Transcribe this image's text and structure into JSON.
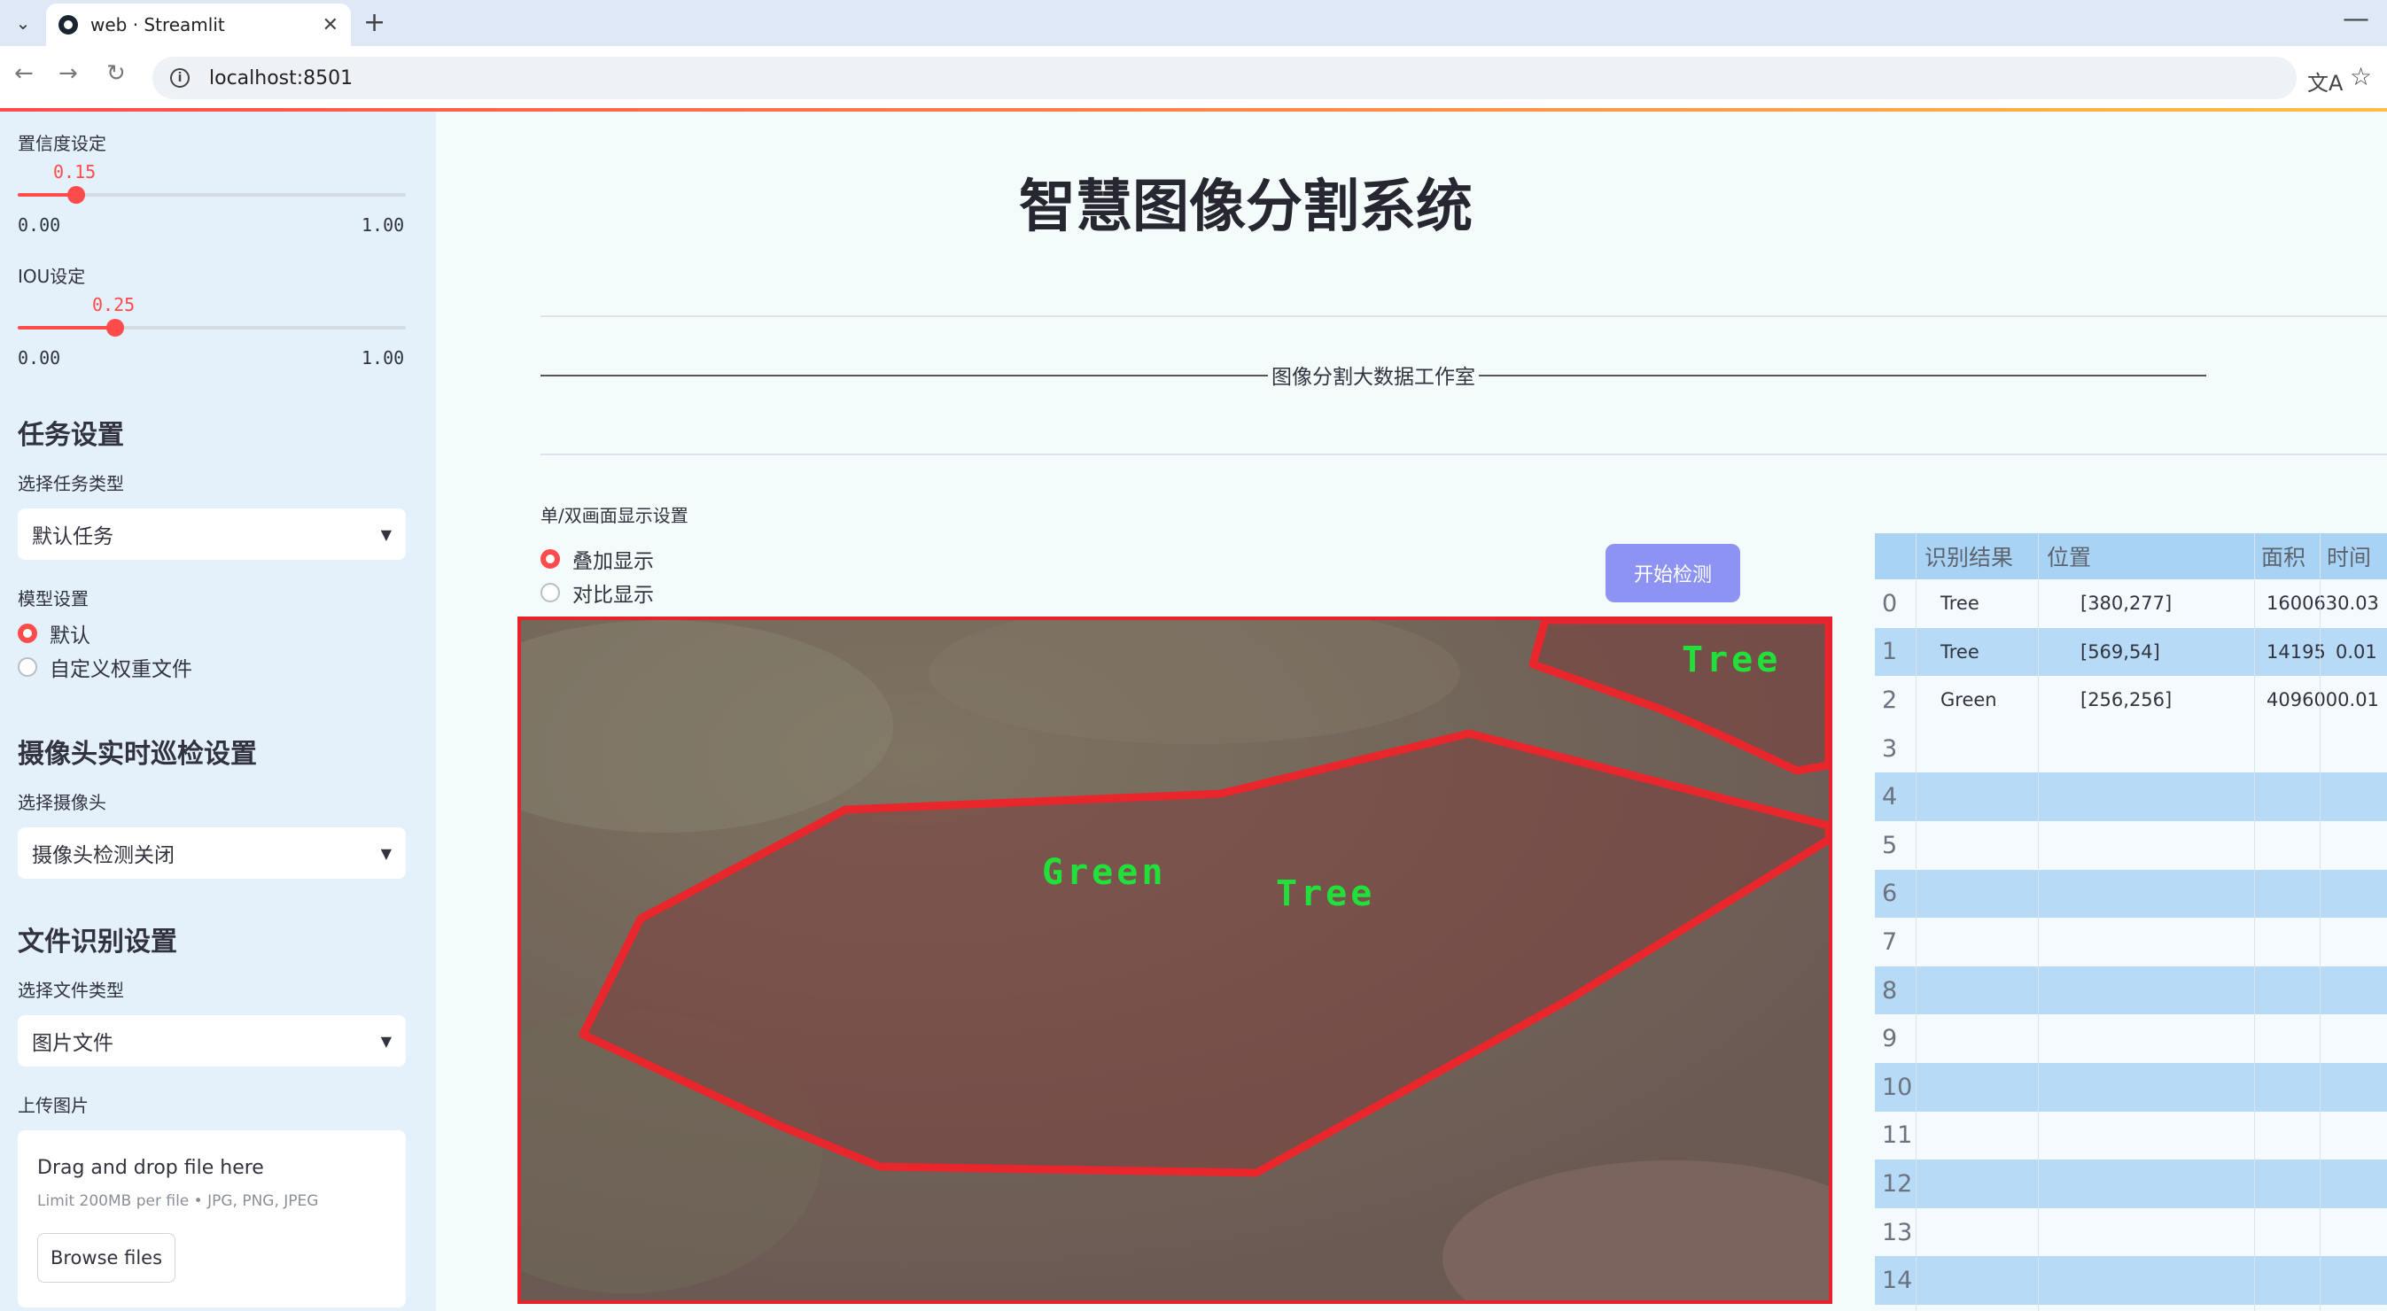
{
  "browser": {
    "tab_title": "web · Streamlit",
    "url": "localhost:8501",
    "new_tab": "+",
    "minimize": "—"
  },
  "sidebar": {
    "confidence": {
      "label": "置信度设定",
      "value": "0.15",
      "min": "0.00",
      "max": "1.00",
      "fraction": 0.15
    },
    "iou": {
      "label": "IOU设定",
      "value": "0.25",
      "min": "0.00",
      "max": "1.00",
      "fraction": 0.25
    },
    "task_section": "任务设置",
    "task_type_label": "选择任务类型",
    "task_type_value": "默认任务",
    "model_label": "模型设置",
    "model_options": [
      "默认",
      "自定义权重文件"
    ],
    "model_selected": 0,
    "camera_section": "摄像头实时巡检设置",
    "camera_label": "选择摄像头",
    "camera_value": "摄像头检测关闭",
    "file_section": "文件识别设置",
    "file_type_label": "选择文件类型",
    "file_type_value": "图片文件",
    "upload_label": "上传图片",
    "upload_title": "Drag and drop file here",
    "upload_limit": "Limit 200MB per file • JPG, PNG, JPEG",
    "browse_label": "Browse files"
  },
  "main": {
    "title": "智慧图像分割系统",
    "studio": "图像分割大数据工作室",
    "display_label": "单/双画面显示设置",
    "display_options": [
      "叠加显示",
      "对比显示"
    ],
    "display_selected": 0,
    "start_button": "开始检测",
    "image_labels": [
      "Green",
      "Tree",
      "Tree"
    ]
  },
  "table": {
    "columns": [
      "识别结果",
      "位置",
      "面积",
      "时间"
    ],
    "rows": [
      {
        "index": "0",
        "result": "Tree",
        "position": "[380,277]",
        "area": "1600630.03",
        "time": ""
      },
      {
        "index": "1",
        "result": "Tree",
        "position": "[569,54]",
        "area": "14195",
        "time": "0.01"
      },
      {
        "index": "2",
        "result": "Green",
        "position": "[256,256]",
        "area": "4096000.01",
        "time": ""
      },
      {
        "index": "3",
        "result": "",
        "position": "",
        "area": "",
        "time": ""
      },
      {
        "index": "4",
        "result": "",
        "position": "",
        "area": "",
        "time": ""
      },
      {
        "index": "5",
        "result": "",
        "position": "",
        "area": "",
        "time": ""
      },
      {
        "index": "6",
        "result": "",
        "position": "",
        "area": "",
        "time": ""
      },
      {
        "index": "7",
        "result": "",
        "position": "",
        "area": "",
        "time": ""
      },
      {
        "index": "8",
        "result": "",
        "position": "",
        "area": "",
        "time": ""
      },
      {
        "index": "9",
        "result": "",
        "position": "",
        "area": "",
        "time": ""
      },
      {
        "index": "10",
        "result": "",
        "position": "",
        "area": "",
        "time": ""
      },
      {
        "index": "11",
        "result": "",
        "position": "",
        "area": "",
        "time": ""
      },
      {
        "index": "12",
        "result": "",
        "position": "",
        "area": "",
        "time": ""
      },
      {
        "index": "13",
        "result": "",
        "position": "",
        "area": "",
        "time": ""
      },
      {
        "index": "14",
        "result": "",
        "position": "",
        "area": "",
        "time": ""
      }
    ]
  },
  "colors": {
    "accent": "#ff4b4b",
    "button": "#8d93f2",
    "mask_outline": "#e8222b",
    "label_green": "#22e03a"
  }
}
